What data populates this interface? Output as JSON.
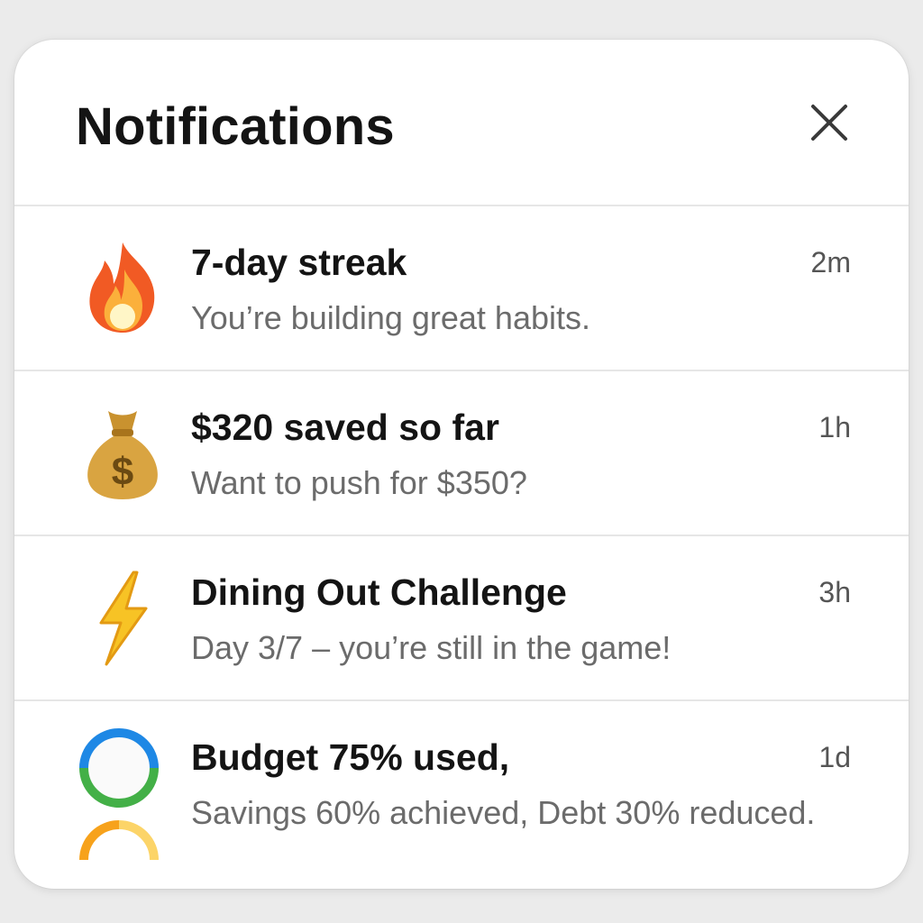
{
  "header": {
    "title": "Notifications",
    "close_icon": "close-icon"
  },
  "notifications": [
    {
      "icon": "fire-icon",
      "title": "7-day streak",
      "body": "You’re building great habits.",
      "time": "2m"
    },
    {
      "icon": "money-bag-icon",
      "title": "$320 saved so far",
      "body": "Want to push for $350?",
      "time": "1h"
    },
    {
      "icon": "lightning-icon",
      "title": "Dining Out Challenge",
      "body": "Day 3/7 – you’re still in the game!",
      "time": "3h"
    },
    {
      "icon": "progress-rings-icon",
      "title": "Budget 75% used,",
      "body": "Savings 60% achieved, Debt 30% reduced.",
      "time": "1d",
      "budget_used": 0.75,
      "savings_achieved": 0.6,
      "debt_reduced": 0.3
    }
  ],
  "colors": {
    "fire_outer": "#f15a24",
    "fire_inner": "#fbb03b",
    "money_bag": "#d9a441",
    "lightning": "#f7c325",
    "ring_blue": "#1e88e5",
    "ring_green": "#43b047",
    "ring_orange": "#f7a21b"
  }
}
